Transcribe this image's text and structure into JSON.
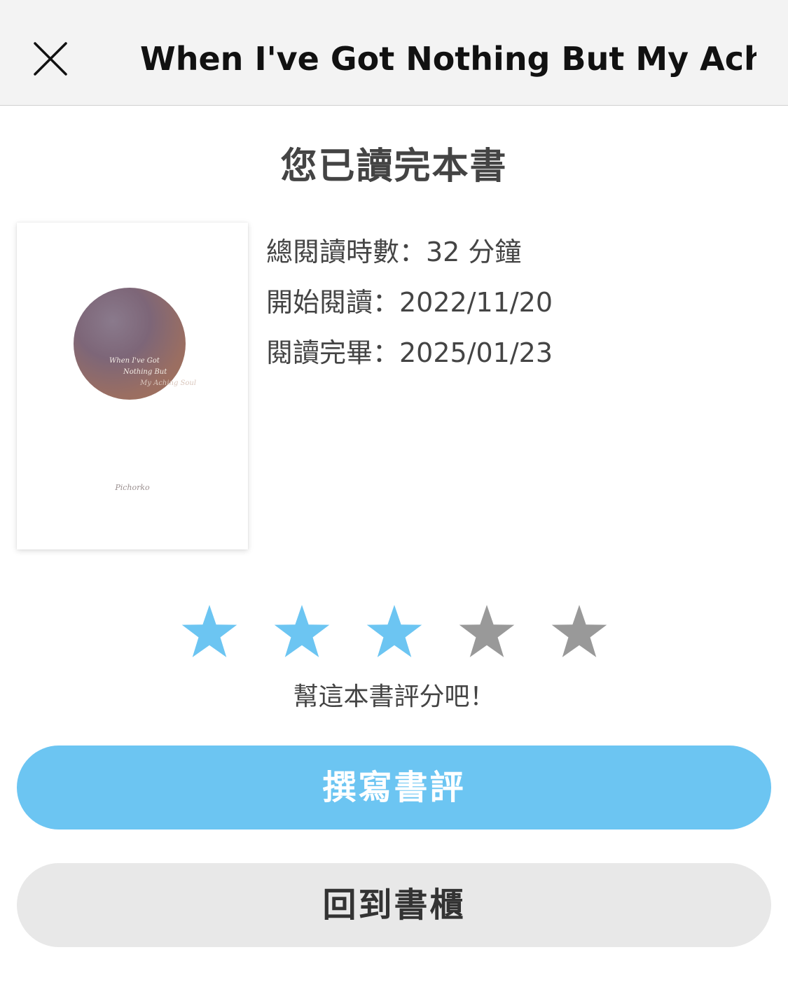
{
  "header": {
    "title": "When I've Got Nothing But My Achi...",
    "close_icon": "close-icon"
  },
  "finished": {
    "title": "您已讀完本書"
  },
  "book": {
    "cover_title_lines": [
      "When I've Got",
      "Nothing But",
      "My Aching Soul"
    ],
    "cover_author": "Pichorko"
  },
  "stats": {
    "total_time": "總閱讀時數：32 分鐘",
    "start_date": "開始閱讀：2022/11/20",
    "end_date": "閱讀完畢：2025/01/23"
  },
  "rating": {
    "max": 5,
    "value": 3,
    "active_color": "#6cc5f2",
    "inactive_color": "#999999",
    "prompt": "幫這本書評分吧！"
  },
  "buttons": {
    "write_review": "撰寫書評",
    "back_to_shelf": "回到書櫃"
  }
}
